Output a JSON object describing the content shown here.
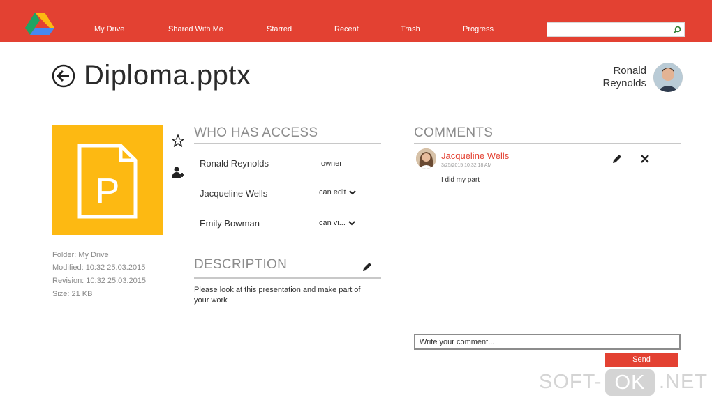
{
  "nav": {
    "items": [
      {
        "label": "My Drive"
      },
      {
        "label": "Shared With Me"
      },
      {
        "label": "Starred"
      },
      {
        "label": "Recent"
      },
      {
        "label": "Trash"
      },
      {
        "label": "Progress"
      }
    ],
    "search": {
      "value": "",
      "placeholder": ""
    }
  },
  "header": {
    "file_title": "Diploma.pptx",
    "user": {
      "name_line1": "Ronald",
      "name_line2": "Reynolds"
    }
  },
  "file": {
    "type_letter": "P",
    "meta": {
      "folder": "Folder: My Drive",
      "modified": "Modified: 10:32 25.03.2015",
      "revision": "Revision: 10:32 25.03.2015",
      "size": "Size: 21 KB"
    }
  },
  "access": {
    "title": "WHO HAS ACCESS",
    "rows": [
      {
        "name": "Ronald Reynolds",
        "role": "owner"
      },
      {
        "name": "Jacqueline Wells",
        "role": "can edit"
      },
      {
        "name": "Emily Bowman",
        "role": "can vi..."
      }
    ]
  },
  "description": {
    "title": "DESCRIPTION",
    "text": "Please look at this presentation and make part of your work"
  },
  "comments": {
    "title": "COMMENTS",
    "items": [
      {
        "author": "Jacqueline Wells",
        "date": "3/25/2015 10:32:18 AM",
        "text": "I did my part"
      }
    ],
    "input_placeholder": "Write your comment...",
    "send_label": "Send"
  },
  "watermark": {
    "left": "SOFT-",
    "box": "OK",
    "right": ".NET"
  },
  "colors": {
    "accent": "#e34132",
    "file_tile": "#fdb912",
    "muted": "#8c8c8c"
  },
  "icons": [
    "google-drive-logo",
    "search-icon",
    "back-arrow-icon",
    "star-icon",
    "add-person-icon",
    "pencil-icon",
    "close-icon",
    "chevron-down-icon"
  ]
}
